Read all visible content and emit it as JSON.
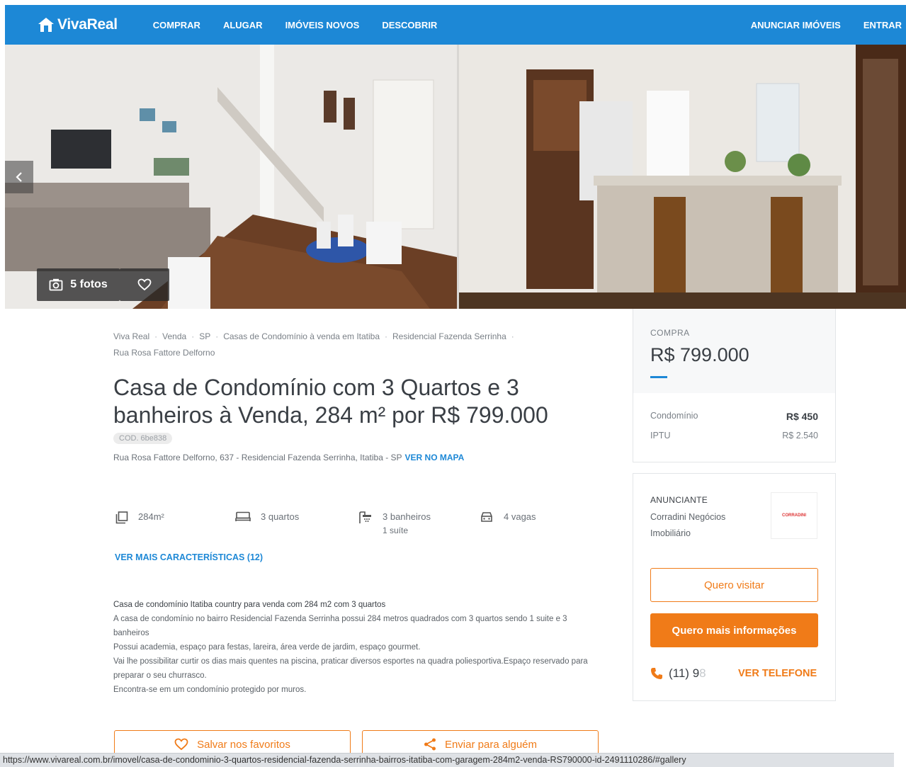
{
  "header": {
    "logo_text": "VivaReal",
    "nav_left": [
      "COMPRAR",
      "ALUGAR",
      "IMÓVEIS NOVOS",
      "DESCOBRIR"
    ],
    "nav_right": [
      "ANUNCIAR IMÓVEIS",
      "ENTRAR"
    ]
  },
  "gallery": {
    "photos_label": "5 fotos"
  },
  "breadcrumb": [
    "Viva Real",
    "Venda",
    "SP",
    "Casas de Condomínio à venda em Itatiba",
    "Residencial Fazenda Serrinha",
    "Rua Rosa Fattore Delforno"
  ],
  "listing": {
    "title": "Casa de Condomínio com 3 Quartos e 3 banheiros à Venda, 284 m² por R$ 799.000",
    "code": "COD. 6be838",
    "address": "Rua Rosa Fattore Delforno, 637 - Residencial Fazenda Serrinha, Itatiba - SP",
    "map_link": "VER NO MAPA",
    "features": {
      "area": "284m²",
      "bedrooms": "3 quartos",
      "bathrooms": "3 banheiros",
      "suites": "1 suíte",
      "parking": "4 vagas"
    },
    "more_features": "VER MAIS CARACTERÍSTICAS (12)",
    "description": [
      "Casa de condomínio Itatiba country para venda com 284 m2 com 3 quartos",
      "A casa de condomínio no bairro Residencial Fazenda Serrinha possui 284 metros quadrados com 3 quartos sendo 1 suite e 3 banheiros",
      "Possui academia, espaço para festas, lareira, área verde de jardim, espaço gourmet.",
      "Vai lhe possibilitar curtir os dias mais quentes na piscina, praticar diversos esportes na quadra poliesportiva.Espaço reservado para preparar o seu churrasco.",
      "Encontra-se em um condomínio protegido por muros."
    ],
    "save_favorite": "Salvar nos favoritos",
    "send_to": "Enviar para alguém"
  },
  "price": {
    "label": "COMPRA",
    "value": "R$ 799.000",
    "condo_label": "Condomínio",
    "condo_value": "R$ 450",
    "iptu_label": "IPTU",
    "iptu_value": "R$ 2.540"
  },
  "advertiser": {
    "label": "ANUNCIANTE",
    "name": "Corradini Negócios Imobiliário",
    "logo_text": "CORRADINI",
    "visit_button": "Quero visitar",
    "info_button": "Quero mais informações",
    "phone_visible": "(11) 9",
    "phone_faded": "8",
    "show_phone": "VER TELEFONE"
  },
  "status_url": "https://www.vivareal.com.br/imovel/casa-de-condominio-3-quartos-residencial-fazenda-serrinha-bairros-itatiba-com-garagem-284m2-venda-RS790000-id-2491110286/#gallery",
  "colors": {
    "brand_blue": "#1d88d6",
    "accent_orange": "#f07b18"
  }
}
